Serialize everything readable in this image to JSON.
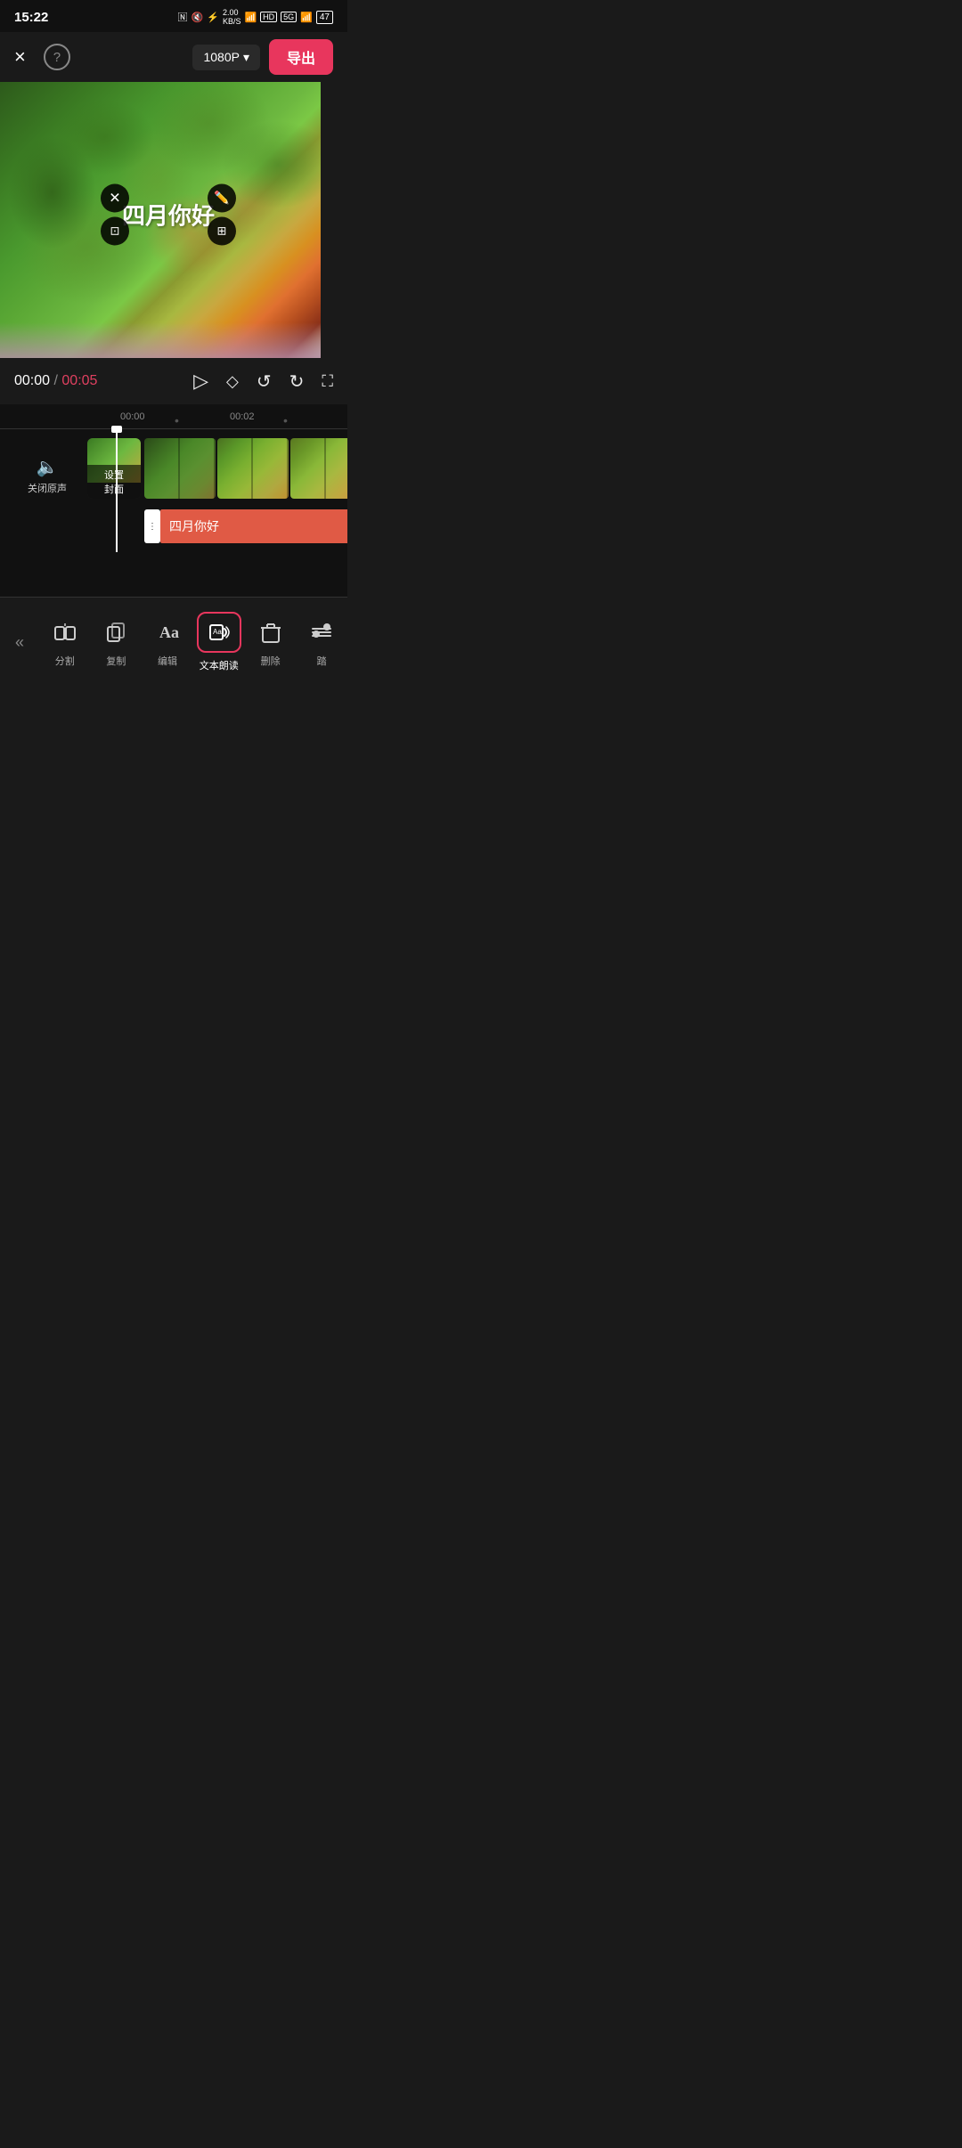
{
  "statusBar": {
    "time": "15:22",
    "battery": "47",
    "network": "5G",
    "speed": "2.00 KB/S"
  },
  "toolbar": {
    "closeLabel": "×",
    "helpLabel": "?",
    "resolutionLabel": "1080P",
    "exportLabel": "导出"
  },
  "videoPreview": {
    "textOverlay": "四月你好",
    "timestamp": "00:00",
    "totalTime": "00:05"
  },
  "playback": {
    "currentTime": "00:00",
    "separator": "/",
    "totalTime": "00:05"
  },
  "timeline": {
    "marker1": "00:00",
    "marker2": "00:02",
    "muteLabel": "关闭原声",
    "coverLabel1": "设置",
    "coverLabel2": "封面",
    "addClipIcon": "+",
    "textTrackContent": "四月你好"
  },
  "bottomToolbar": {
    "collapseIcon": "«",
    "items": [
      {
        "id": "split",
        "label": "分割",
        "icon": "split"
      },
      {
        "id": "copy",
        "label": "复制",
        "icon": "copy"
      },
      {
        "id": "edit",
        "label": "编辑",
        "icon": "edit"
      },
      {
        "id": "tts",
        "label": "文本朗读",
        "icon": "tts",
        "active": true
      },
      {
        "id": "delete",
        "label": "删除",
        "icon": "delete"
      },
      {
        "id": "more",
        "label": "踏",
        "icon": "more"
      }
    ]
  }
}
